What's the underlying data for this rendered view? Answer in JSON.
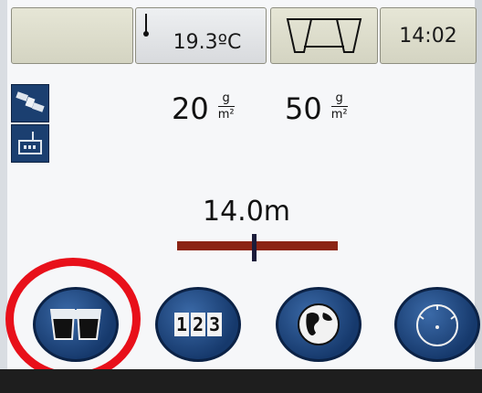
{
  "status_bar": {
    "temperature": "19.3ºC",
    "time": "14:02"
  },
  "rates": {
    "left": {
      "value": "20",
      "unit_top": "g",
      "unit_bottom": "m²"
    },
    "right": {
      "value": "50",
      "unit_top": "g",
      "unit_bottom": "m²"
    }
  },
  "working_width": {
    "value": "14.0m",
    "marker_position": 0.48
  },
  "bottom_buttons": {
    "calculator_digits": [
      "1",
      "2",
      "3"
    ]
  },
  "colors": {
    "button_blue": "#16396c",
    "bar_red": "#8b2414",
    "highlight_red": "#e8101a"
  }
}
